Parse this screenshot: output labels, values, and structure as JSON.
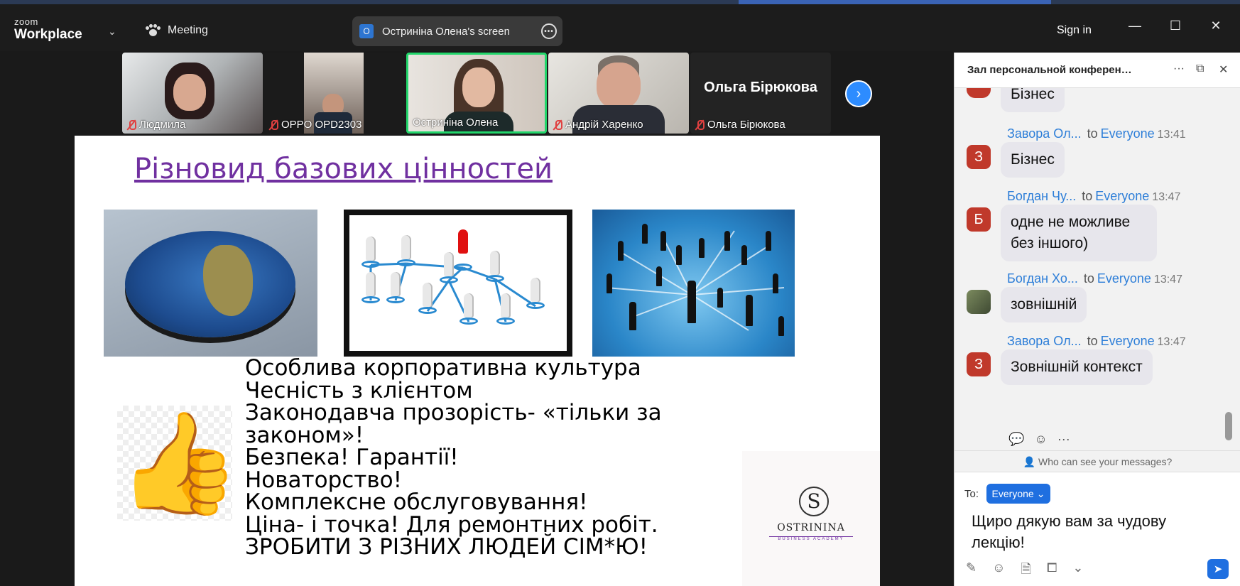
{
  "titlebar": {
    "logo_small": "zoom",
    "logo_big": "Workplace",
    "meeting_label": "Meeting",
    "screen_share_initial": "O",
    "screen_share_label": "Остриніна Олена's screen",
    "sign_in": "Sign in"
  },
  "participants": [
    {
      "name": "Людмила",
      "muted": true
    },
    {
      "name": "OPPO OPD2303",
      "muted": true
    },
    {
      "name": "Остриніна Олена",
      "muted": false,
      "active_speaker": true
    },
    {
      "name": "Андрій Харенко",
      "muted": true
    },
    {
      "name": "Ольга Бірюкова",
      "muted": true,
      "video_off_label": "Ольга Бірюкова"
    }
  ],
  "slide": {
    "title": "Різновид базових цінностей",
    "bullets": [
      "Особлива корпоративна культура",
      "Чесність з клієнтом",
      "Законодавча прозорість- «тільки за законом»!",
      "Безпека! Гарантії!",
      "Новаторство!",
      "Комплексне обслуговування!",
      "Ціна- і точка! Для ремонтних робіт.",
      "ЗРОБИТИ З РІЗНИХ ЛЮДЕЙ СІМ*Ю!"
    ],
    "brand_name": "OSTRININA",
    "brand_sub": "BUSINESS ACADEMY"
  },
  "chat": {
    "header_title": "Зал персональной конференци...",
    "messages": [
      {
        "sender": "",
        "to": "",
        "recipient": "",
        "time": "",
        "avatar": "",
        "avatar_color": "#c0392b",
        "text": "Бізнес"
      },
      {
        "sender": "Завора Ол...",
        "to": "to",
        "recipient": "Everyone",
        "time": "13:41",
        "avatar": "З",
        "avatar_color": "#c0392b",
        "text": "Бізнес"
      },
      {
        "sender": "Богдан Чу...",
        "to": "to",
        "recipient": "Everyone",
        "time": "13:47",
        "avatar": "Б",
        "avatar_color": "#c0392b",
        "text": "одне не можливе без іншого)"
      },
      {
        "sender": "Богдан Хо...",
        "to": "to",
        "recipient": "Everyone",
        "time": "13:47",
        "avatar": "",
        "avatar_color": "#5d6b4a",
        "text": "зовнішній"
      },
      {
        "sender": "Завора Ол...",
        "to": "to",
        "recipient": "Everyone",
        "time": "13:47",
        "avatar": "З",
        "avatar_color": "#c0392b",
        "text": "Зовнішній контекст"
      }
    ],
    "who_can_see": "Who can see your messages?",
    "to_label": "To:",
    "recipient_button": "Everyone",
    "draft_text": "Щиро дякую вам за чудову лекцію!"
  }
}
